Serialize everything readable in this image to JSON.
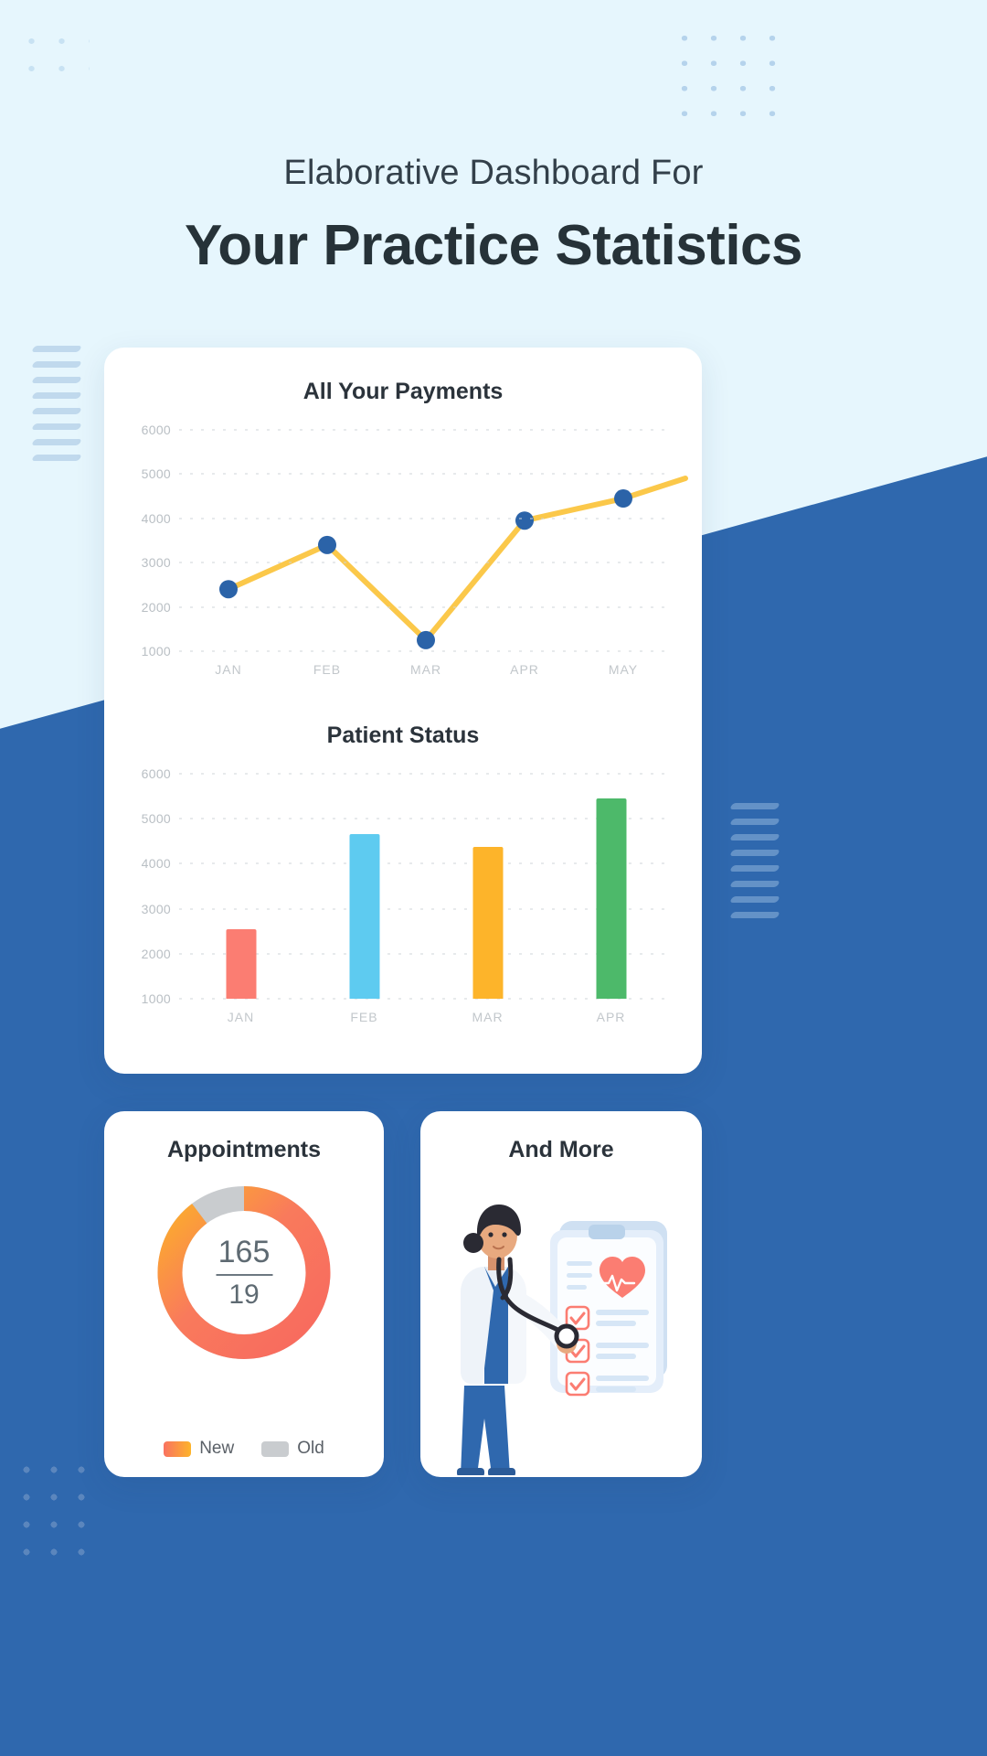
{
  "page": {
    "heading_small": "Elaborative Dashboard For",
    "heading_large": "Your Practice Statistics",
    "background_light": "#e6f6fd",
    "background_blue": "#2f68ae"
  },
  "cards": {
    "payments_title": "All Your Payments",
    "patient_status_title": "Patient Status",
    "appointments_title": "Appointments",
    "and_more_title": "And More"
  },
  "appointments": {
    "value_top": "165",
    "value_bottom": "19",
    "legend": [
      {
        "label": "New",
        "color": "#f97261"
      },
      {
        "label": "Old",
        "color": "#c9cccf"
      }
    ]
  },
  "chart_data": [
    {
      "type": "line",
      "title": "All Your Payments",
      "categories": [
        "JAN",
        "FEB",
        "MAR",
        "APR",
        "MAY"
      ],
      "values": [
        2400,
        3400,
        1250,
        3950,
        4450
      ],
      "ylim": [
        1000,
        6000
      ],
      "yticks": [
        1000,
        2000,
        3000,
        4000,
        5000,
        6000
      ],
      "ytick_labels": [
        "1000",
        "2000",
        "3000",
        "4000",
        "5000",
        "6000"
      ],
      "xlabel": "",
      "ylabel": "",
      "grid": true,
      "line_color": "#fbc84a",
      "marker_color": "#2b63a8",
      "legend": false
    },
    {
      "type": "bar",
      "title": "Patient Status",
      "categories": [
        "JAN",
        "FEB",
        "MAR",
        "APR"
      ],
      "values": [
        2550,
        4650,
        4370,
        5450
      ],
      "ylim": [
        1000,
        6000
      ],
      "yticks": [
        1000,
        2000,
        3000,
        4000,
        5000,
        6000
      ],
      "ytick_labels": [
        "1000",
        "2000",
        "3000",
        "4000",
        "5000",
        "6000"
      ],
      "bar_colors": [
        "#fb7d72",
        "#5ecbf0",
        "#fdb42a",
        "#4db96a"
      ],
      "xlabel": "",
      "ylabel": "",
      "grid": true,
      "legend": false
    },
    {
      "type": "pie",
      "title": "Appointments",
      "labels": [
        "New",
        "Old"
      ],
      "values": [
        165,
        19
      ],
      "display_ratio": "165 / 19",
      "colors": [
        "#f97261",
        "#c9cccf"
      ],
      "donut": true
    }
  ]
}
